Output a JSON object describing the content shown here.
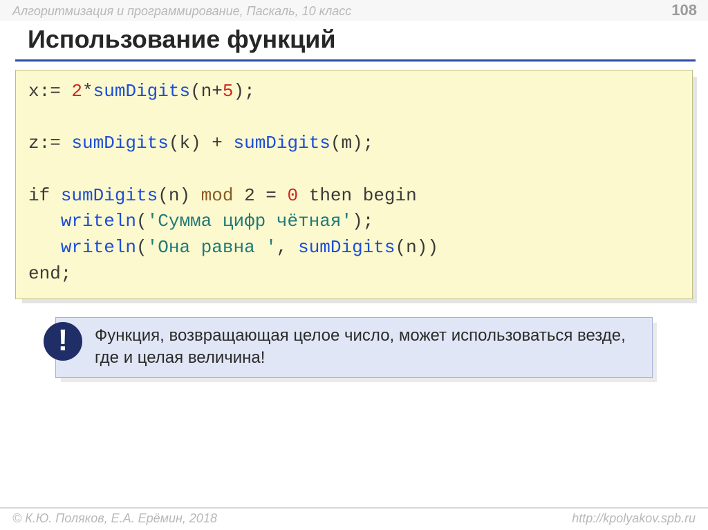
{
  "header": {
    "left": "Алгоритмизация и программирование, Паскаль, 10 класс",
    "page": "108"
  },
  "title": "Использование функций",
  "code": {
    "l1": {
      "a": "x:= ",
      "b": "2",
      "c": "*",
      "d": "sumDigits",
      "e": "(n+",
      "f": "5",
      "g": ");"
    },
    "l2": {
      "a": "z:= ",
      "b": "sumDigits",
      "c": "(k) + ",
      "d": "sumDigits",
      "e": "(m);"
    },
    "l3": {
      "a": "if ",
      "b": "sumDigits",
      "c": "(n) ",
      "d": "mod",
      "e": " 2 = ",
      "f": "0",
      "g": " then begin"
    },
    "l4": {
      "a": "   ",
      "b": "writeln",
      "c": "(",
      "d": "'Сумма цифр чётная'",
      "e": ");"
    },
    "l5": {
      "a": "   ",
      "b": "writeln",
      "c": "(",
      "d": "'Она равна '",
      "e": ", ",
      "f": "sumDigits",
      "g": "(n))"
    },
    "l6": {
      "a": "end;"
    }
  },
  "note": {
    "badge": "!",
    "text": "Функция, возвращающая целое число, может использоваться везде, где и целая величина!"
  },
  "footer": {
    "left": "© К.Ю. Поляков, Е.А. Ерёмин, 2018",
    "right": "http://kpolyakov.spb.ru"
  }
}
